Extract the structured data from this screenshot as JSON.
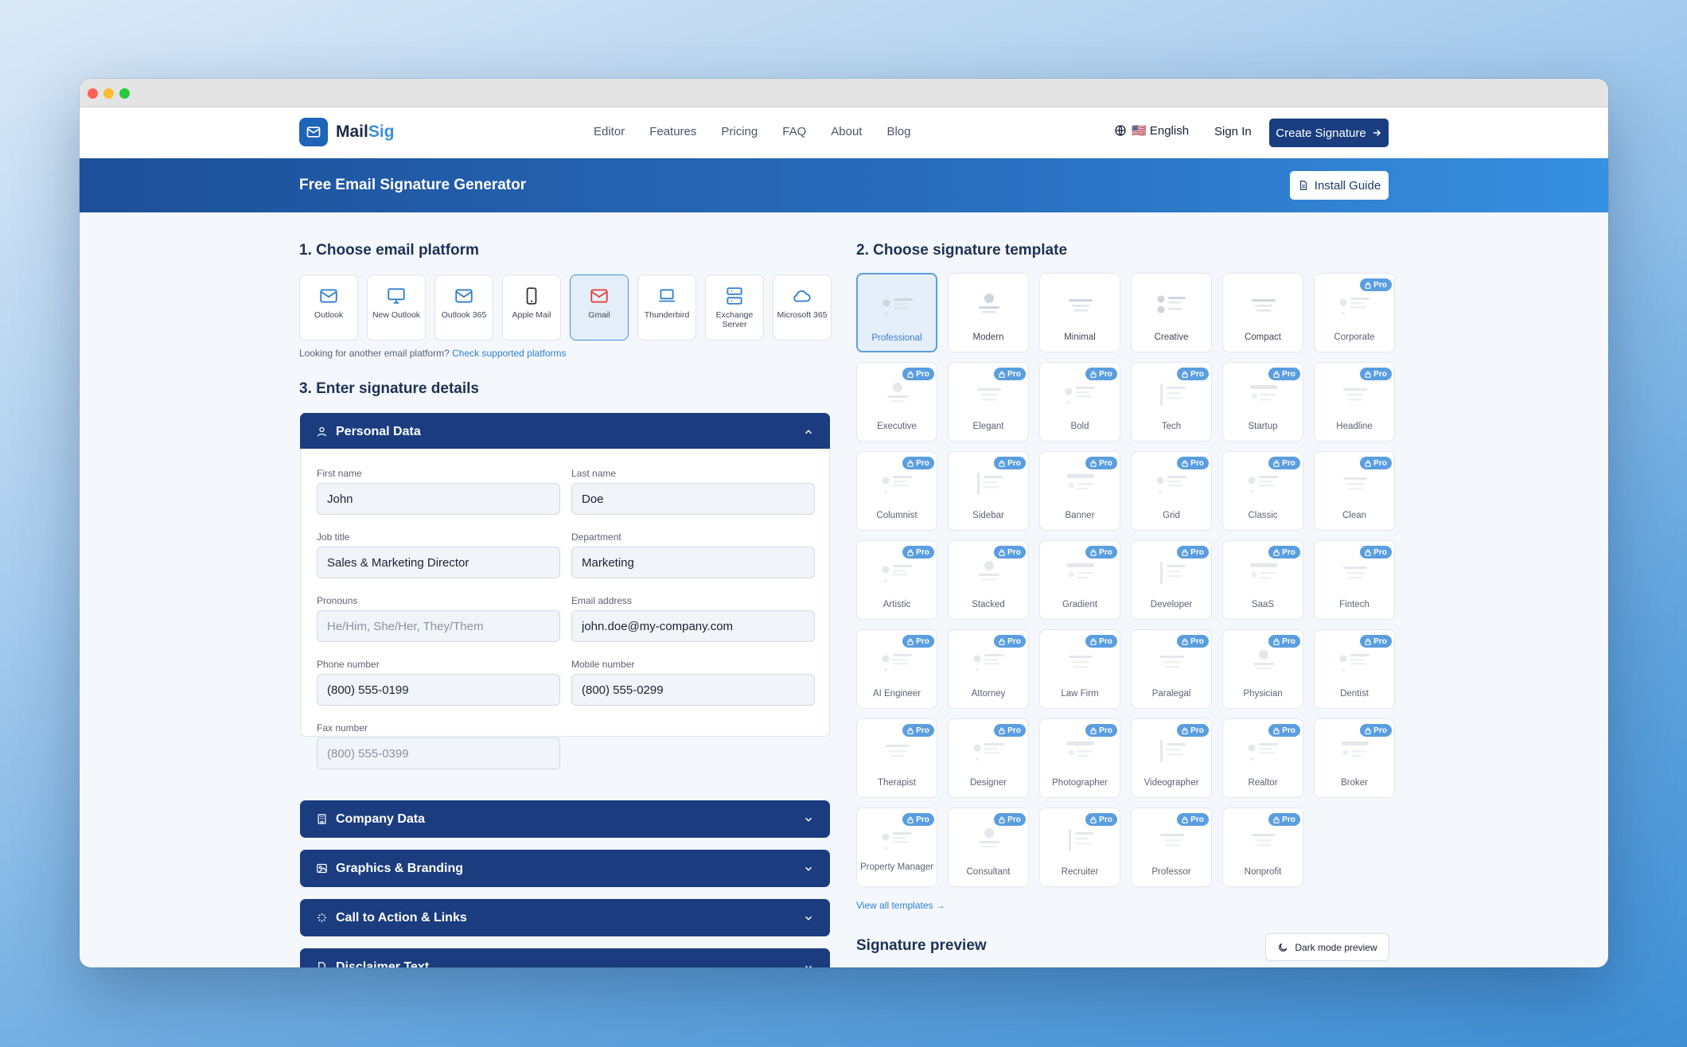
{
  "brand": {
    "name_main": "Mail",
    "name_accent": "Sig"
  },
  "nav": {
    "links": [
      "Editor",
      "Features",
      "Pricing",
      "FAQ",
      "About",
      "Blog"
    ],
    "language": "🇺🇸 English",
    "sign_in": "Sign In",
    "cta": "Create Signature"
  },
  "banner": {
    "title": "Free Email Signature Generator",
    "install_label": "Install Guide"
  },
  "platforms": {
    "heading": "1. Choose email platform",
    "items": [
      {
        "label": "Outlook",
        "icon": "mail-icon",
        "active": false
      },
      {
        "label": "New Outlook",
        "icon": "monitor-icon",
        "active": false
      },
      {
        "label": "Outlook 365",
        "icon": "mail-icon",
        "active": false
      },
      {
        "label": "Apple Mail",
        "icon": "phone-icon",
        "active": false
      },
      {
        "label": "Gmail",
        "icon": "mail-icon",
        "active": true
      },
      {
        "label": "Thunderbird",
        "icon": "laptop-icon",
        "active": false
      },
      {
        "label": "Exchange Server",
        "icon": "server-icon",
        "active": false
      },
      {
        "label": "Microsoft 365",
        "icon": "cloud-icon",
        "active": false
      }
    ],
    "hint_text": "Looking for another email platform?",
    "hint_link": "Check supported platforms"
  },
  "details": {
    "heading": "3. Enter signature details",
    "sections": {
      "personal": "Personal Data",
      "company": "Company Data",
      "graphics": "Graphics & Branding",
      "cta": "Call to Action & Links",
      "disclaimer": "Disclaimer Text"
    },
    "fields": {
      "first_name": {
        "label": "First name",
        "value": "John",
        "placeholder": ""
      },
      "last_name": {
        "label": "Last name",
        "value": "Doe",
        "placeholder": ""
      },
      "job_title": {
        "label": "Job title",
        "value": "Sales & Marketing Director",
        "placeholder": ""
      },
      "department": {
        "label": "Department",
        "value": "Marketing",
        "placeholder": ""
      },
      "pronouns": {
        "label": "Pronouns",
        "value": "",
        "placeholder": "He/Him, She/Her, They/Them"
      },
      "email": {
        "label": "Email address",
        "value": "john.doe@my-company.com",
        "placeholder": ""
      },
      "phone": {
        "label": "Phone number",
        "value": "(800) 555-0199",
        "placeholder": ""
      },
      "mobile": {
        "label": "Mobile number",
        "value": "(800) 555-0299",
        "placeholder": ""
      },
      "fax": {
        "label": "Fax number",
        "value": "",
        "placeholder": "(800) 555-0399"
      }
    }
  },
  "templates": {
    "heading": "2. Choose signature template",
    "pro_label": "Pro",
    "items": [
      {
        "name": "Professional",
        "pro": false,
        "active": true,
        "style": 0
      },
      {
        "name": "Modern",
        "pro": false,
        "active": false,
        "style": 1
      },
      {
        "name": "Minimal",
        "pro": false,
        "active": false,
        "style": 2
      },
      {
        "name": "Creative",
        "pro": false,
        "active": false,
        "style": 3
      },
      {
        "name": "Compact",
        "pro": false,
        "active": false,
        "style": 2
      },
      {
        "name": "Corporate",
        "pro": true,
        "active": false,
        "style": 0
      },
      {
        "name": "Executive",
        "pro": true,
        "active": false,
        "style": 1
      },
      {
        "name": "Elegant",
        "pro": true,
        "active": false,
        "style": 2
      },
      {
        "name": "Bold",
        "pro": true,
        "active": false,
        "style": 0
      },
      {
        "name": "Tech",
        "pro": true,
        "active": false,
        "style": 4
      },
      {
        "name": "Startup",
        "pro": true,
        "active": false,
        "style": 5
      },
      {
        "name": "Headline",
        "pro": true,
        "active": false,
        "style": 2
      },
      {
        "name": "Columnist",
        "pro": true,
        "active": false,
        "style": 0
      },
      {
        "name": "Sidebar",
        "pro": true,
        "active": false,
        "style": 4
      },
      {
        "name": "Banner",
        "pro": true,
        "active": false,
        "style": 5
      },
      {
        "name": "Grid",
        "pro": true,
        "active": false,
        "style": 0
      },
      {
        "name": "Classic",
        "pro": true,
        "active": false,
        "style": 0
      },
      {
        "name": "Clean",
        "pro": true,
        "active": false,
        "style": 2
      },
      {
        "name": "Artistic",
        "pro": true,
        "active": false,
        "style": 0
      },
      {
        "name": "Stacked",
        "pro": true,
        "active": false,
        "style": 1
      },
      {
        "name": "Gradient",
        "pro": true,
        "active": false,
        "style": 5
      },
      {
        "name": "Developer",
        "pro": true,
        "active": false,
        "style": 4
      },
      {
        "name": "SaaS",
        "pro": true,
        "active": false,
        "style": 5
      },
      {
        "name": "Fintech",
        "pro": true,
        "active": false,
        "style": 2
      },
      {
        "name": "AI Engineer",
        "pro": true,
        "active": false,
        "style": 0
      },
      {
        "name": "Attorney",
        "pro": true,
        "active": false,
        "style": 0
      },
      {
        "name": "Law Firm",
        "pro": true,
        "active": false,
        "style": 2
      },
      {
        "name": "Paralegal",
        "pro": true,
        "active": false,
        "style": 2
      },
      {
        "name": "Physician",
        "pro": true,
        "active": false,
        "style": 1
      },
      {
        "name": "Dentist",
        "pro": true,
        "active": false,
        "style": 0
      },
      {
        "name": "Therapist",
        "pro": true,
        "active": false,
        "style": 2
      },
      {
        "name": "Designer",
        "pro": true,
        "active": false,
        "style": 0
      },
      {
        "name": "Photographer",
        "pro": true,
        "active": false,
        "style": 5
      },
      {
        "name": "Videographer",
        "pro": true,
        "active": false,
        "style": 4
      },
      {
        "name": "Realtor",
        "pro": true,
        "active": false,
        "style": 0
      },
      {
        "name": "Broker",
        "pro": true,
        "active": false,
        "style": 5
      },
      {
        "name": "Property Manager",
        "pro": true,
        "active": false,
        "style": 0
      },
      {
        "name": "Consultant",
        "pro": true,
        "active": false,
        "style": 1
      },
      {
        "name": "Recruiter",
        "pro": true,
        "active": false,
        "style": 4
      },
      {
        "name": "Professor",
        "pro": true,
        "active": false,
        "style": 2
      },
      {
        "name": "Nonprofit",
        "pro": true,
        "active": false,
        "style": 2
      }
    ],
    "view_all": "View all templates →"
  },
  "preview": {
    "heading": "Signature preview",
    "dark_mode_label": "Dark mode preview"
  },
  "colors": {
    "primary": "#1b3d7f",
    "accent": "#3b8fdc",
    "pro_badge": "#5a9ee0"
  }
}
